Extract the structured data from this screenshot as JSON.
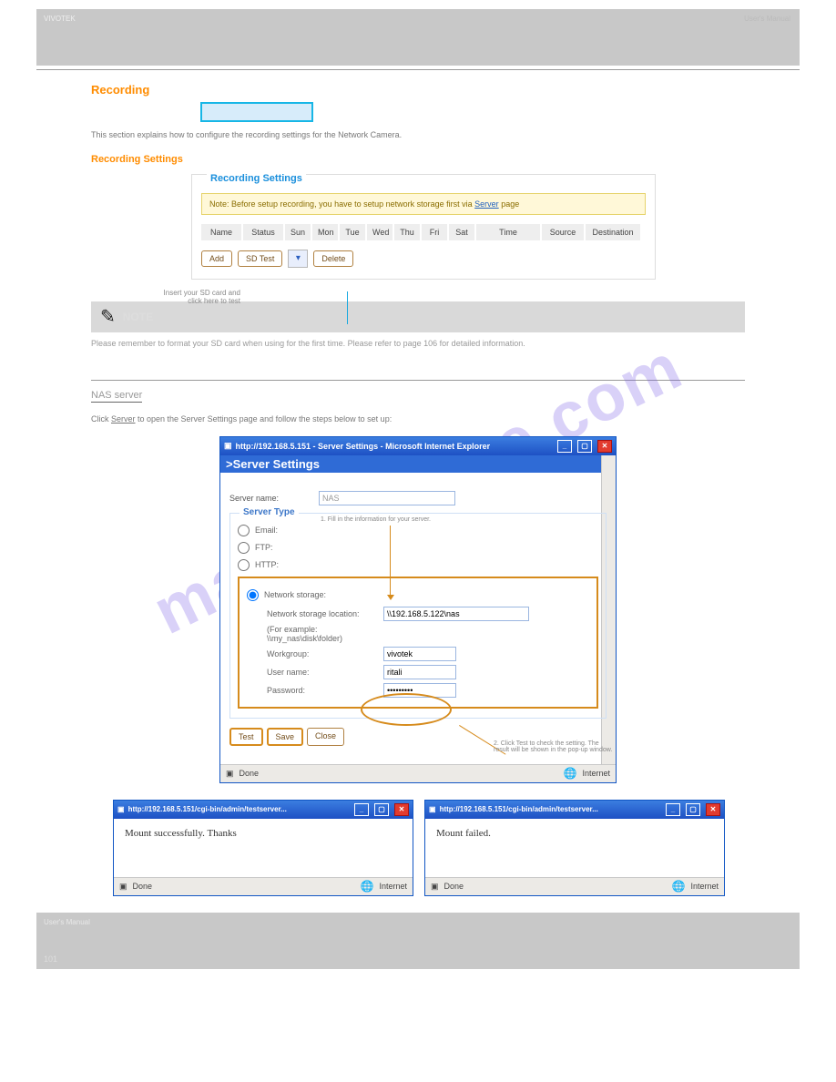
{
  "header": {
    "left": "VIVOTEK",
    "right": "User's Manual"
  },
  "recording": {
    "title": "Recording",
    "p1": "This section explains how to configure the recording settings for the Network Camera.",
    "subtitle": "Recording Settings",
    "panel_title": "Recording Settings",
    "note": "Note: Before setup recording, you have to setup network storage first via",
    "note_link": "Server",
    "note_tail": " page",
    "cols": [
      "Name",
      "Status",
      "Sun",
      "Mon",
      "Tue",
      "Wed",
      "Thu",
      "Fri",
      "Sat",
      "Time",
      "Source",
      "Destination"
    ],
    "btn_add": "Add",
    "btn_sdtest": "SD Test",
    "btn_delete": "Delete",
    "callout": "Insert your SD card\nand click here to test"
  },
  "note": {
    "title": "NOTE",
    "text": "Please remember to format your SD card when using for the first time. Please refer to page 106 for detailed information."
  },
  "nas": {
    "heading": "NAS server",
    "p": "Click Server to open the Server Settings page and follow the steps below to set up:",
    "step_title": "Server Settings",
    "label1": "Server name:",
    "val1": "NAS",
    "fs": "Server Type",
    "r1": "Email:",
    "r2": "FTP:",
    "r3": "HTTP:",
    "r4": "Network storage:",
    "loc_label": "Network storage location:",
    "loc_val": "\\\\192.168.5.122\\nas",
    "ex1": "(For example:",
    "ex2": "\\\\my_nas\\disk\\folder)",
    "wg_label": "Workgroup:",
    "wg_val": "vivotek",
    "un_label": "User name:",
    "un_val": "ritali",
    "pw_label": "Password:",
    "btn_test": "Test",
    "btn_save": "Save",
    "btn_close": "Close",
    "status_done": "Done",
    "status_net": "Internet",
    "anno1": "1. Fill in the information for your server.",
    "anno2": "2. Click Test to check the setting. The result will be shown in the pop-up window.",
    "title_bar": "http://192.168.5.151 - Server Settings - Microsoft Internet Explorer"
  },
  "popups": {
    "title": "http://192.168.5.151/cgi-bin/admin/testserver...",
    "ok": "Mount successfully. Thanks",
    "fail": "Mount failed.",
    "done": "Done",
    "net": "Internet"
  },
  "footer": {
    "center": "User's Manual",
    "page": "101"
  },
  "watermark": "manualshive.com"
}
